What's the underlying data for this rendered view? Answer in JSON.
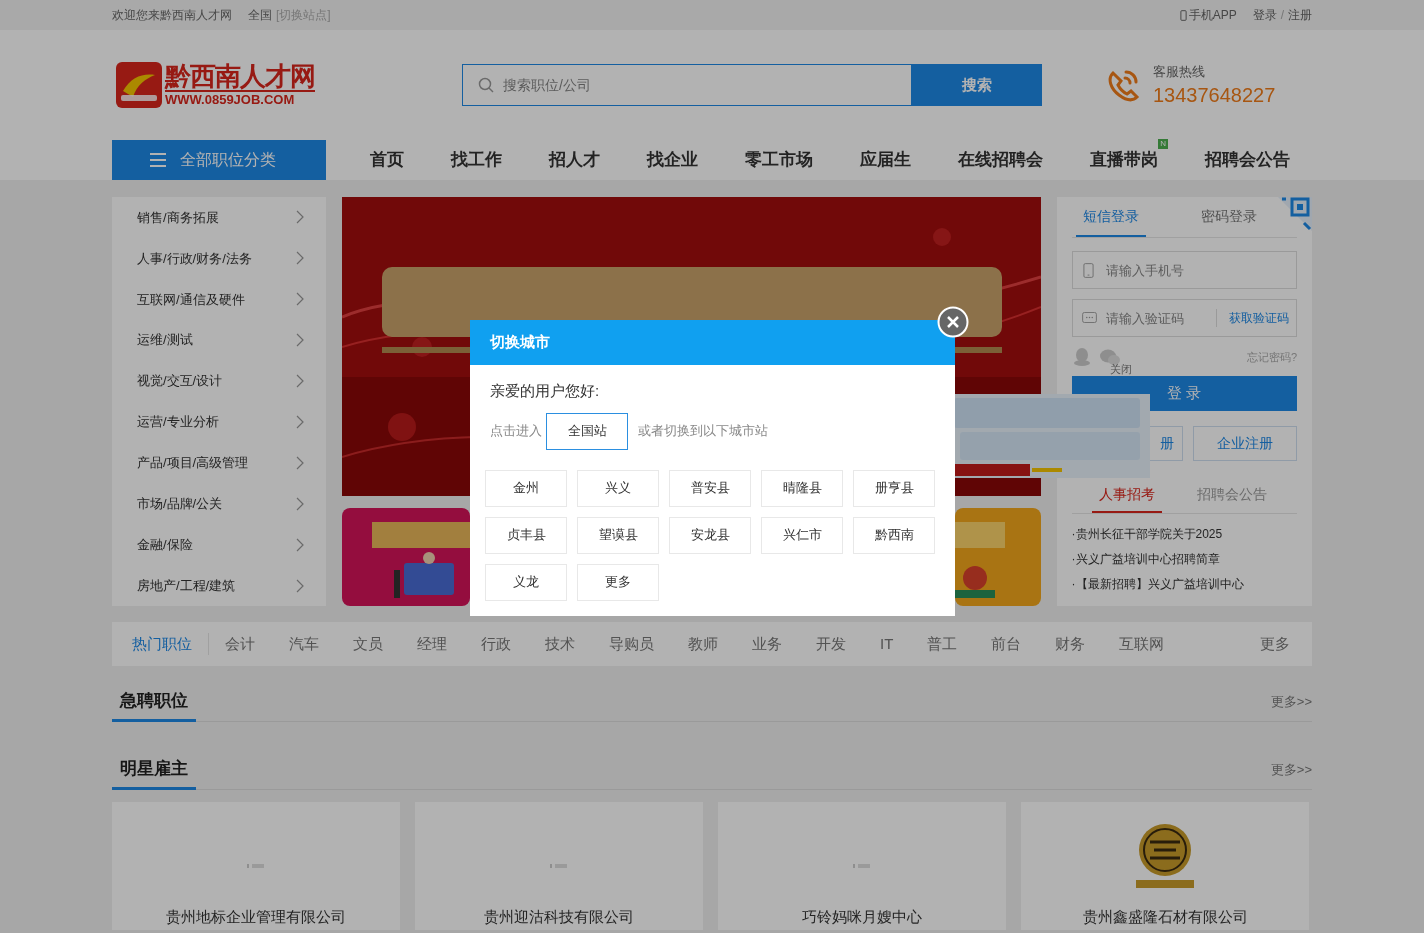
{
  "top_bar": {
    "welcome": "欢迎您来黔西南人才网",
    "region": "全国",
    "switch_link": "[切换站点]",
    "app_link": "手机APP",
    "login": "登录",
    "separator": "/",
    "register": "注册"
  },
  "header": {
    "logo_title": "黔西南人才网",
    "logo_url": "WWW.0859JOB.COM",
    "search_placeholder": "搜索职位/公司",
    "search_button": "搜索",
    "hotline_label": "客服热线",
    "hotline_number": "13437648227"
  },
  "nav": {
    "category_button": "全部职位分类",
    "items": [
      {
        "label": "首页"
      },
      {
        "label": "找工作"
      },
      {
        "label": "招人才"
      },
      {
        "label": "找企业"
      },
      {
        "label": "零工市场"
      },
      {
        "label": "应届生"
      },
      {
        "label": "在线招聘会"
      },
      {
        "label": "直播带岗",
        "badge": "N"
      },
      {
        "label": "招聘会公告"
      }
    ]
  },
  "sidebar": {
    "items": [
      "销售/商务拓展",
      "人事/行政/财务/法务",
      "互联网/通信及硬件",
      "运维/测试",
      "视觉/交互/设计",
      "运营/专业分析",
      "产品/项目/高级管理",
      "市场/品牌/公关",
      "金融/保险",
      "房地产/工程/建筑"
    ]
  },
  "login": {
    "tabs": [
      {
        "label": "短信登录",
        "selected": true
      },
      {
        "label": "密码登录",
        "selected": false
      }
    ],
    "phone_placeholder": "请输入手机号",
    "code_placeholder": "请输入验证码",
    "get_code": "获取验证码",
    "forgot": "忘记密码?",
    "close_text": "关闭",
    "login_button": "登 录",
    "register_buttons": [
      "册",
      "企业注册"
    ],
    "news_tabs": [
      {
        "label": "人事招考",
        "selected": true
      },
      {
        "label": "招聘会公告",
        "selected": false
      }
    ],
    "news": [
      "·贵州长征干部学院关于2025",
      "·兴义广益培训中心招聘简章",
      "·【最新招聘】兴义广益培训中心"
    ]
  },
  "hot_jobs": {
    "items": [
      {
        "label": "热门职位",
        "selected": true
      },
      {
        "label": "会计",
        "selected": false
      },
      {
        "label": "汽车",
        "selected": false
      },
      {
        "label": "文员",
        "selected": false
      },
      {
        "label": "经理",
        "selected": false
      },
      {
        "label": "行政",
        "selected": false
      },
      {
        "label": "技术",
        "selected": false
      },
      {
        "label": "导购员",
        "selected": false
      },
      {
        "label": "教师",
        "selected": false
      },
      {
        "label": "业务",
        "selected": false
      },
      {
        "label": "开发",
        "selected": false
      },
      {
        "label": "IT",
        "selected": false
      },
      {
        "label": "普工",
        "selected": false
      },
      {
        "label": "前台",
        "selected": false
      },
      {
        "label": "财务",
        "selected": false
      },
      {
        "label": "互联网",
        "selected": false
      }
    ],
    "more": "更多"
  },
  "sections": [
    {
      "title": "急聘职位",
      "more": "更多>>"
    },
    {
      "title": "明星雇主",
      "more": "更多>>"
    }
  ],
  "employers": [
    {
      "name": "贵州地标企业管理有限公司",
      "kind": "placeholder"
    },
    {
      "name": "贵州迎沽科技有限公司",
      "kind": "placeholder"
    },
    {
      "name": "巧铃妈咪月嫂中心",
      "kind": "placeholder"
    },
    {
      "name": "贵州鑫盛隆石材有限公司",
      "kind": "logo"
    }
  ],
  "modal": {
    "title": "切换城市",
    "greeting": "亲爱的用户您好:",
    "enter_label": "点击进入",
    "national_button": "全国站",
    "switch_hint": "或者切换到以下城市站",
    "cities": [
      "金州",
      "兴义",
      "普安县",
      "晴隆县",
      "册亨县",
      "贞丰县",
      "望谟县",
      "安龙县",
      "兴仁市",
      "黔西南",
      "义龙",
      "更多"
    ]
  }
}
